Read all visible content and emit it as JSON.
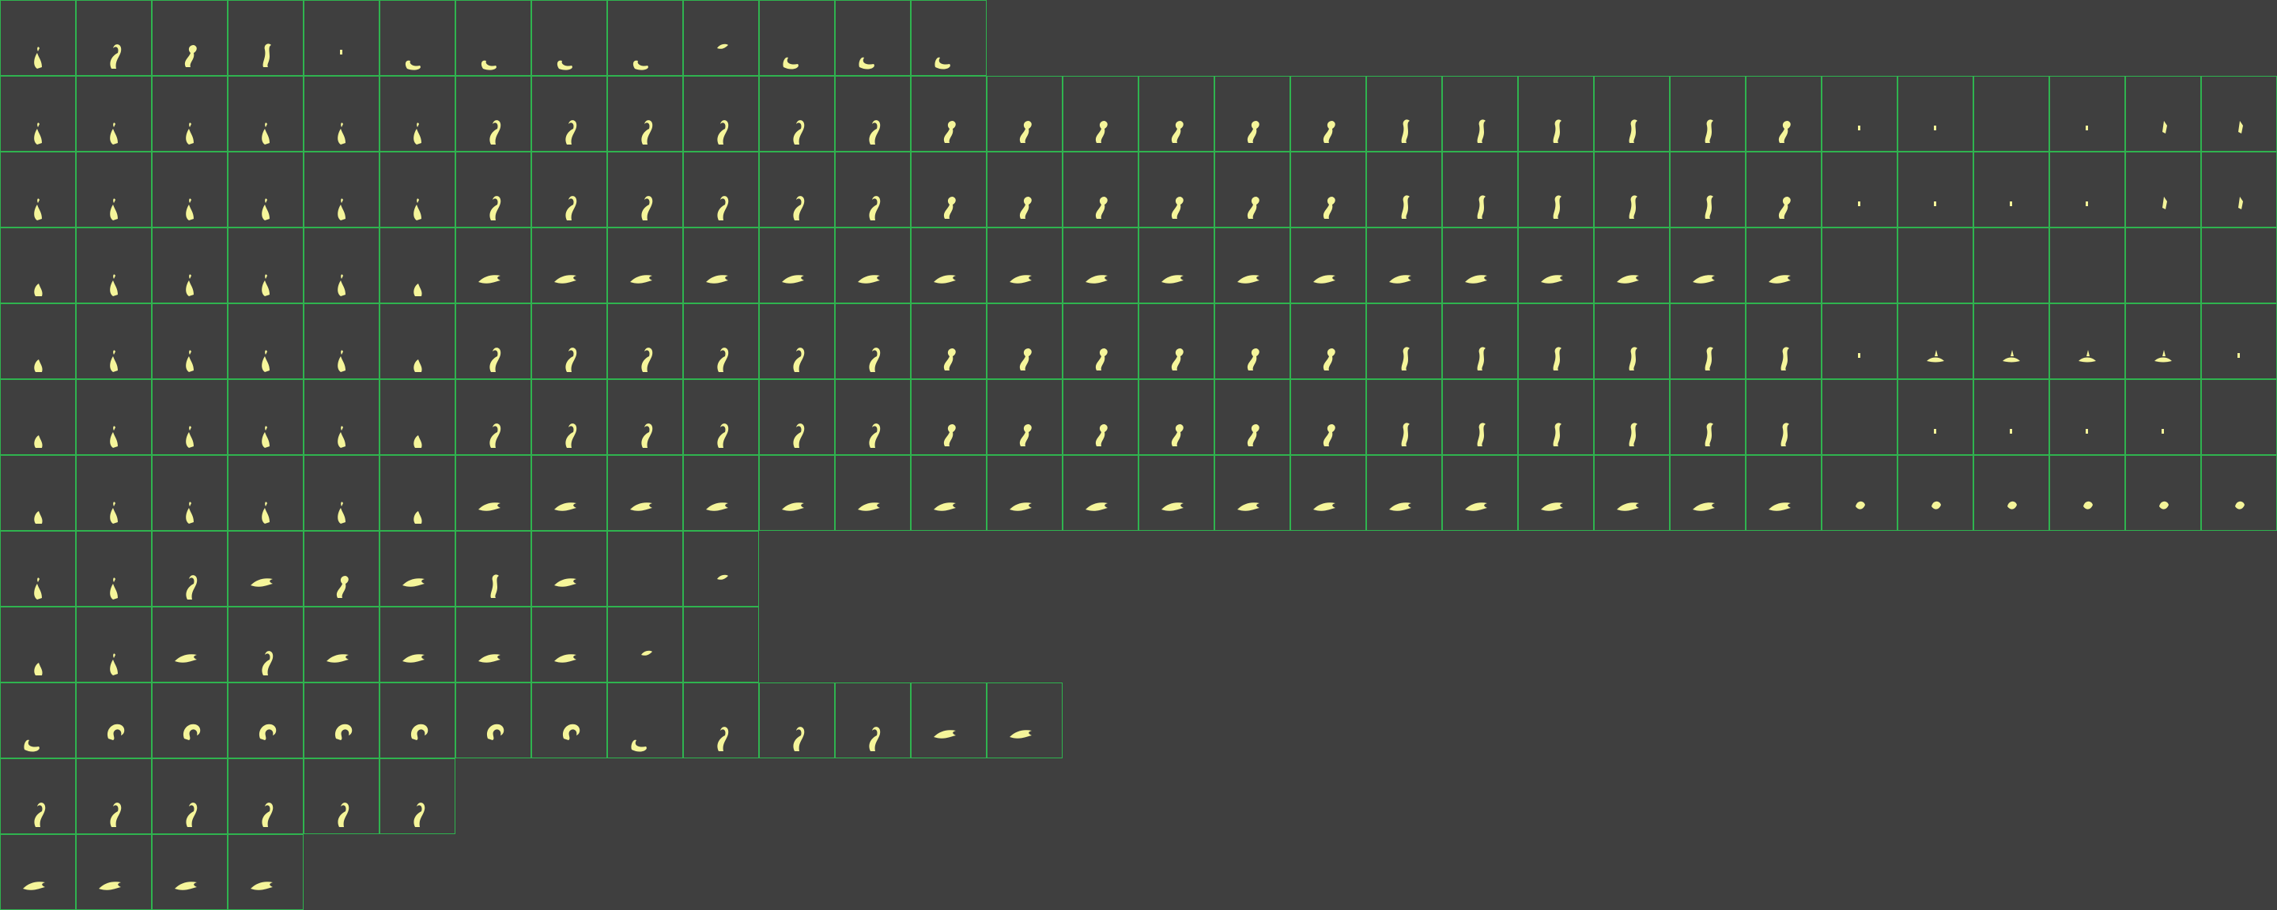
{
  "sheet": {
    "background_color": "#3f3f3f",
    "grid_color": "#2fb34f",
    "sprite_color": "#f5f59a",
    "rows": [
      {
        "name": "row-1",
        "frames": [
          "tail-up",
          "tail-curl",
          "tail-s",
          "tail-s2",
          "dot",
          "tail-side",
          "tail-side",
          "tail-side",
          "tail-side",
          "tiny-leaf",
          "tail-hook",
          "tail-hook",
          "tail-hook"
        ]
      },
      {
        "name": "row-2",
        "frames": [
          "tail-up",
          "tail-up",
          "tail-up",
          "tail-up",
          "tail-up",
          "tail-up",
          "tail-curl",
          "tail-curl",
          "tail-curl",
          "tail-curl",
          "tail-curl",
          "tail-curl",
          "tail-s",
          "tail-s",
          "tail-s",
          "tail-s",
          "tail-s",
          "tail-s",
          "tail-s2",
          "tail-s2",
          "tail-s2",
          "tail-s2",
          "tail-s2",
          "tail-s",
          "dot",
          "dot",
          "empty",
          "dot",
          "spark",
          "spark"
        ]
      },
      {
        "name": "row-3",
        "frames": [
          "tail-up",
          "tail-up",
          "tail-up",
          "tail-up",
          "tail-up",
          "tail-up",
          "tail-curl",
          "tail-curl",
          "tail-curl",
          "tail-curl",
          "tail-curl",
          "tail-curl",
          "tail-s",
          "tail-s",
          "tail-s",
          "tail-s",
          "tail-s",
          "tail-s",
          "tail-s2",
          "tail-s2",
          "tail-s2",
          "tail-s2",
          "tail-s2",
          "tail-s",
          "dot",
          "dot",
          "dot",
          "dot",
          "spark",
          "spark"
        ]
      },
      {
        "name": "row-4",
        "frames": [
          "tail-small",
          "tail-up",
          "tail-up",
          "tail-up",
          "tail-up",
          "tail-small",
          "flame",
          "flame",
          "flame",
          "flame",
          "flame",
          "flame",
          "flame",
          "flame",
          "flame",
          "flame",
          "flame",
          "flame",
          "flame",
          "flame",
          "flame",
          "flame",
          "flame",
          "flame",
          "empty",
          "empty",
          "empty",
          "empty",
          "empty",
          "empty"
        ]
      },
      {
        "name": "row-5",
        "frames": [
          "tail-small",
          "tail-up",
          "tail-up",
          "tail-up",
          "tail-up",
          "tail-small",
          "tail-curl",
          "tail-curl",
          "tail-curl",
          "tail-curl",
          "tail-curl",
          "tail-curl",
          "tail-s",
          "tail-s",
          "tail-s",
          "tail-s",
          "tail-s",
          "tail-s",
          "tail-s2",
          "tail-s2",
          "tail-s2",
          "tail-s2",
          "tail-s2",
          "tail-s2",
          "dot",
          "splash",
          "splash",
          "splash",
          "splash",
          "dot"
        ]
      },
      {
        "name": "row-6",
        "frames": [
          "tail-small",
          "tail-up",
          "tail-up",
          "tail-up",
          "tail-up",
          "tail-small",
          "tail-curl",
          "tail-curl",
          "tail-curl",
          "tail-curl",
          "tail-curl",
          "tail-curl",
          "tail-s",
          "tail-s",
          "tail-s",
          "tail-s",
          "tail-s",
          "tail-s",
          "tail-s2",
          "tail-s2",
          "tail-s2",
          "tail-s2",
          "tail-s2",
          "tail-s2",
          "empty",
          "dot",
          "dot",
          "dot",
          "dot",
          "empty"
        ]
      },
      {
        "name": "row-7",
        "frames": [
          "tail-small",
          "tail-up",
          "tail-up",
          "tail-up",
          "tail-up",
          "tail-small",
          "flame",
          "flame",
          "flame",
          "flame",
          "flame",
          "flame",
          "flame",
          "flame",
          "flame",
          "flame",
          "flame",
          "flame",
          "flame",
          "flame",
          "flame",
          "flame",
          "flame",
          "flame",
          "burst",
          "burst",
          "burst",
          "burst",
          "burst",
          "burst"
        ]
      },
      {
        "name": "row-8",
        "frames": [
          "tail-up",
          "tail-up",
          "tail-curl",
          "flame",
          "tail-s",
          "flame",
          "tail-s2",
          "flame",
          "empty",
          "tiny-leaf"
        ]
      },
      {
        "name": "row-9",
        "frames": [
          "tail-small",
          "tail-up",
          "flame",
          "tail-curl",
          "flame",
          "flame",
          "flame",
          "flame",
          "tiny-leaf",
          "empty"
        ]
      },
      {
        "name": "row-10",
        "frames": [
          "tail-hook",
          "curl-spin",
          "curl-spin",
          "curl-spin",
          "curl-spin",
          "curl-spin",
          "curl-spin",
          "curl-spin",
          "tail-hook",
          "tail-curl",
          "tail-curl",
          "tail-curl",
          "flame",
          "flame"
        ]
      },
      {
        "name": "row-11",
        "frames": [
          "tail-curl",
          "tail-curl",
          "tail-curl",
          "tail-curl",
          "tail-curl",
          "tail-curl"
        ]
      },
      {
        "name": "row-12",
        "frames": [
          "flame",
          "flame",
          "flame",
          "flame"
        ]
      }
    ]
  }
}
